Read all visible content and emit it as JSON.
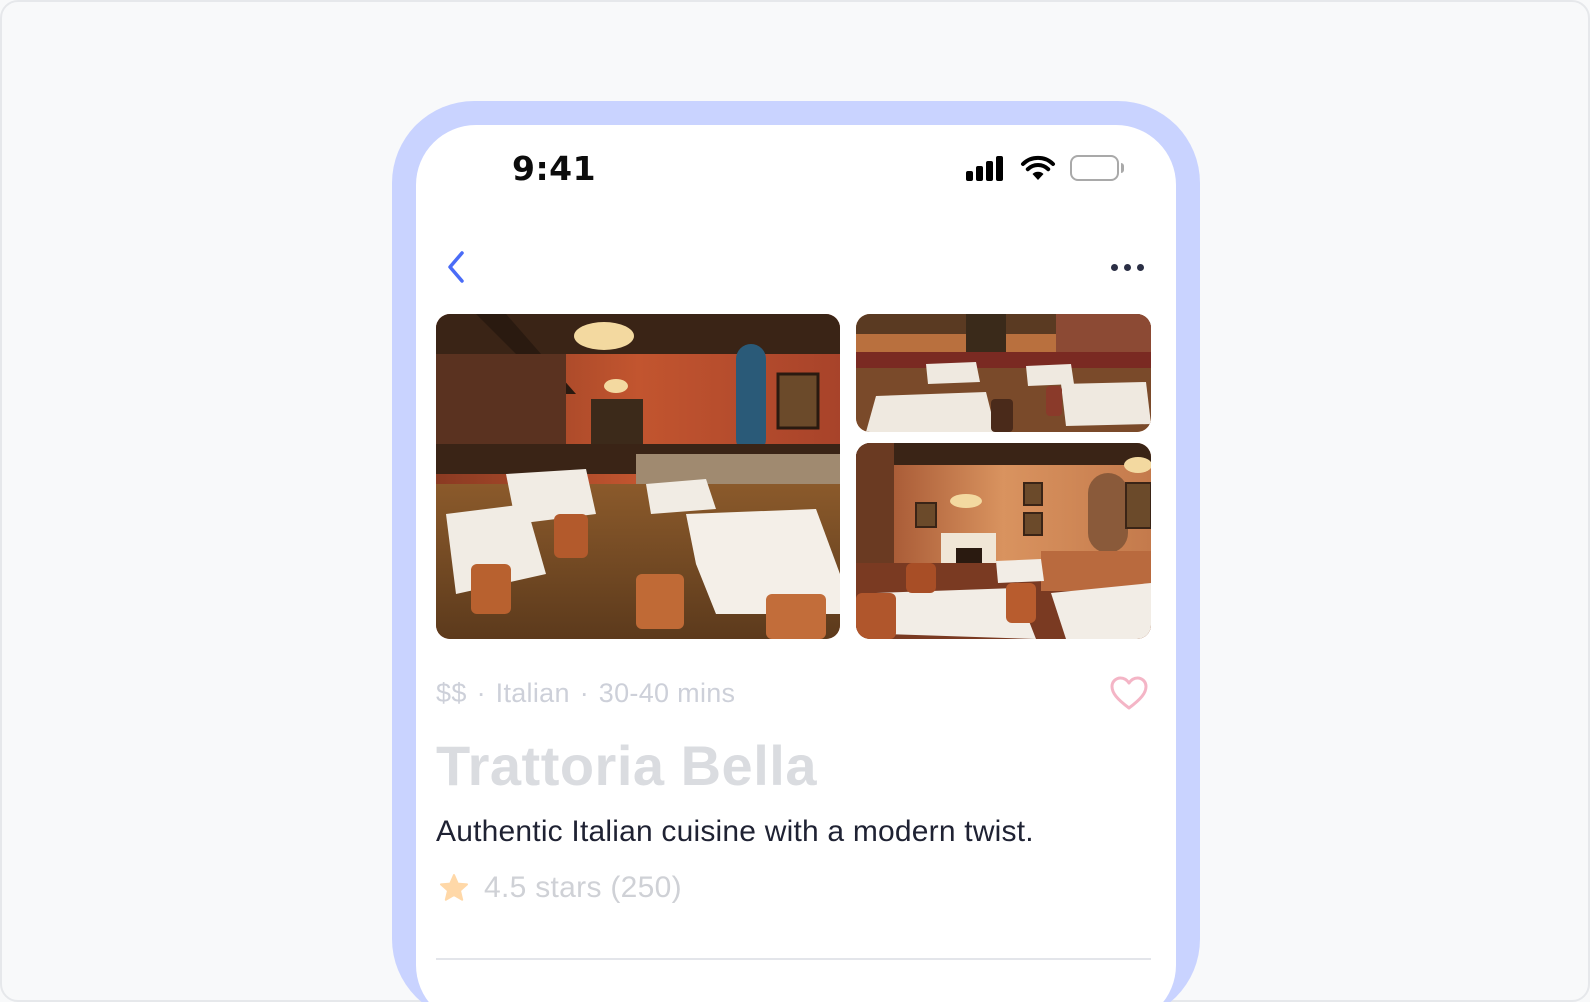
{
  "status_bar": {
    "time": "9:41",
    "icons": [
      "signal-icon",
      "wifi-icon",
      "battery-icon"
    ]
  },
  "nav": {
    "back_icon": "chevron-left-icon",
    "more_icon": "more-horizontal-icon"
  },
  "gallery": {
    "photos": [
      "restaurant-interior-main",
      "restaurant-interior-top",
      "restaurant-interior-bottom"
    ]
  },
  "restaurant": {
    "price": "$$",
    "cuisine": "Italian",
    "delivery_time": "30-40 mins",
    "name": "Trattoria Bella",
    "description": "Authentic Italian cuisine with a modern twist.",
    "rating_text": "4.5 stars (250)",
    "rating_icon": "star-icon",
    "favorite_icon": "heart-icon"
  },
  "colors": {
    "accent": "#4a6cf7",
    "frame": "#c9d3ff",
    "heart": "#f4b5c6",
    "star": "#ffd8a8"
  }
}
